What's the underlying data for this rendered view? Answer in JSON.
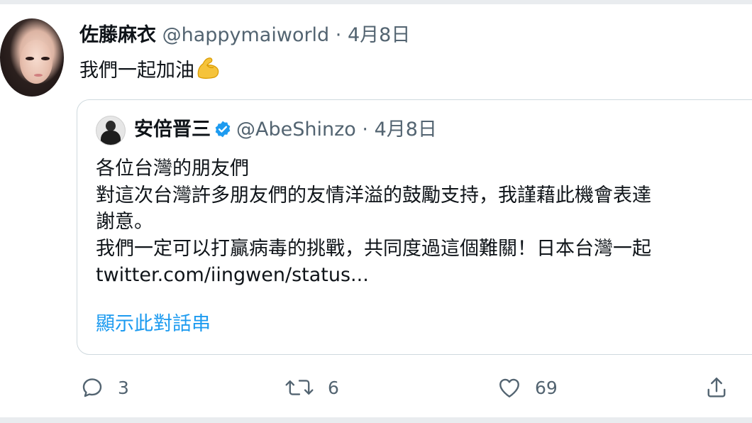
{
  "tweet": {
    "author_name": "佐藤麻衣",
    "author_handle": "@happymaiworld",
    "separator": "·",
    "date": "4月8日",
    "text": "我們一起加油",
    "emoji": "flexed-biceps-emoji"
  },
  "quoted_tweet": {
    "author_name": "安倍晋三",
    "verified": true,
    "author_handle": "@AbeShinzo",
    "separator": "·",
    "date": "4月8日",
    "lines": [
      "各位台灣的朋友們",
      "對這次台灣許多朋友們的友情洋溢的鼓勵支持，我謹藉此機會表達",
      "謝意。",
      "我們一定可以打贏病毒的挑戰，共同度過這個難關！日本台灣一起",
      "twitter.com/iingwen/status..."
    ],
    "show_thread": "顯示此對話串"
  },
  "actions": {
    "reply_count": "3",
    "retweet_count": "6",
    "like_count": "69"
  },
  "colors": {
    "text_primary": "#0f1419",
    "text_secondary": "#536471",
    "accent": "#1d9bf0",
    "border": "#cfd9de"
  }
}
